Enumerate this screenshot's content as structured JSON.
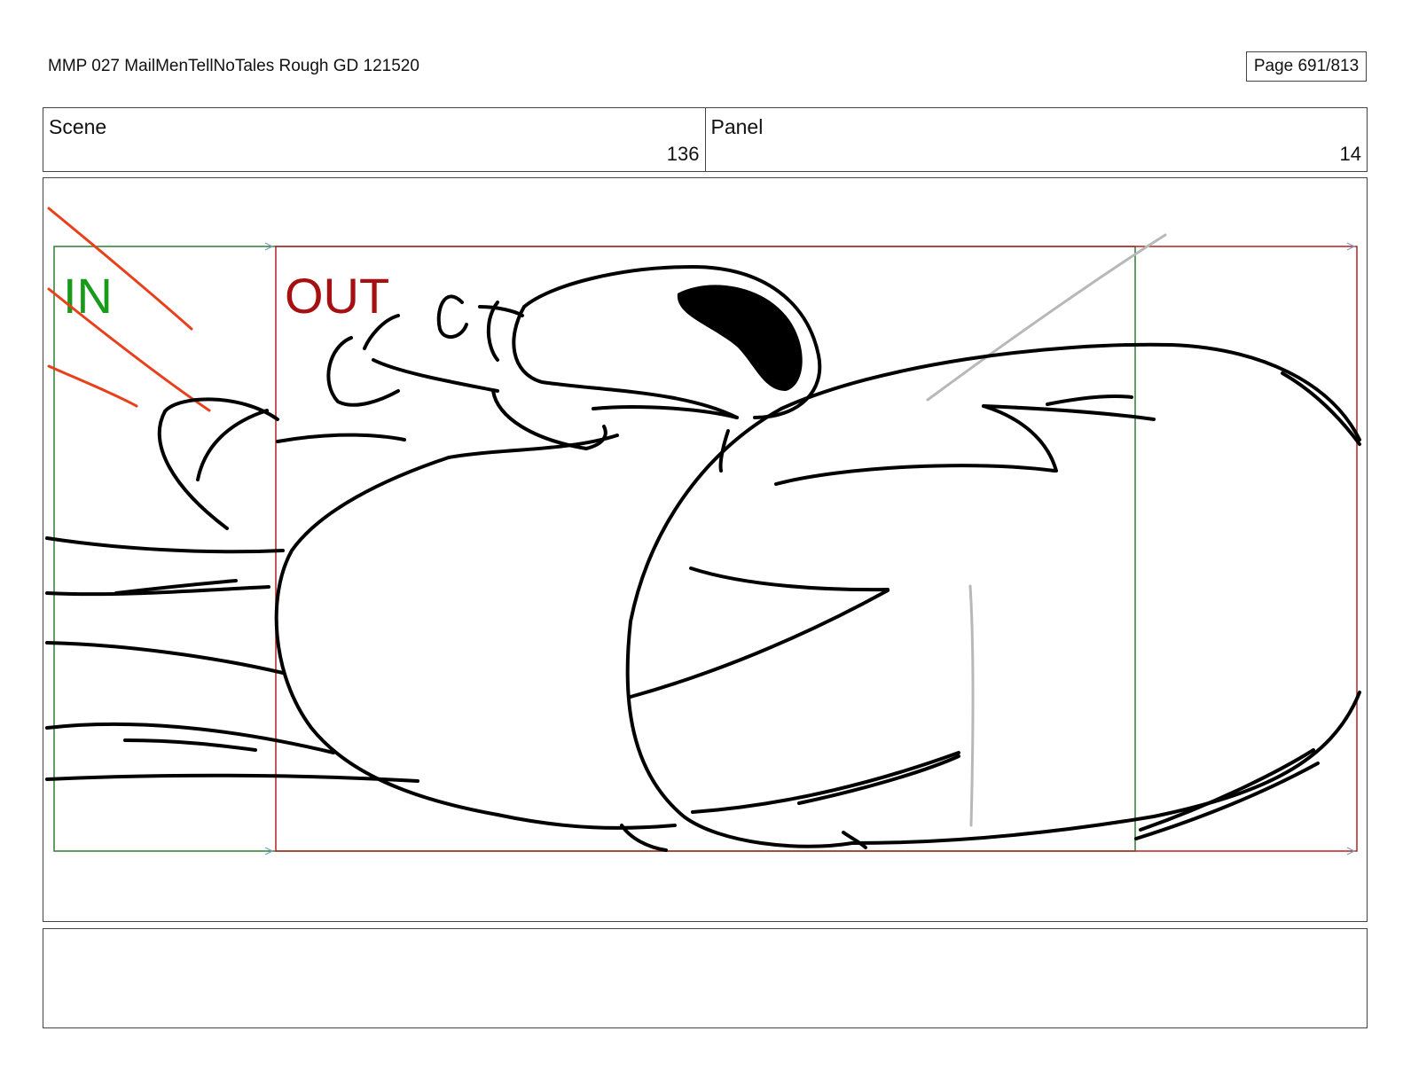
{
  "header": {
    "document_title": "MMP 027 MailMenTellNoTales Rough GD 121520",
    "page_label": "Page 691/813"
  },
  "info": {
    "scene_label": "Scene",
    "scene_number": "136",
    "panel_label": "Panel",
    "panel_number": "14"
  },
  "frame": {
    "in_label": "IN",
    "out_label": "OUT",
    "in_color": "#1a9a1a",
    "out_color": "#a61010",
    "in_frame_color": "#2e7d32",
    "out_frame_color": "#b22222",
    "speed_line_color": "#e8401a"
  },
  "notes": {
    "text": ""
  }
}
